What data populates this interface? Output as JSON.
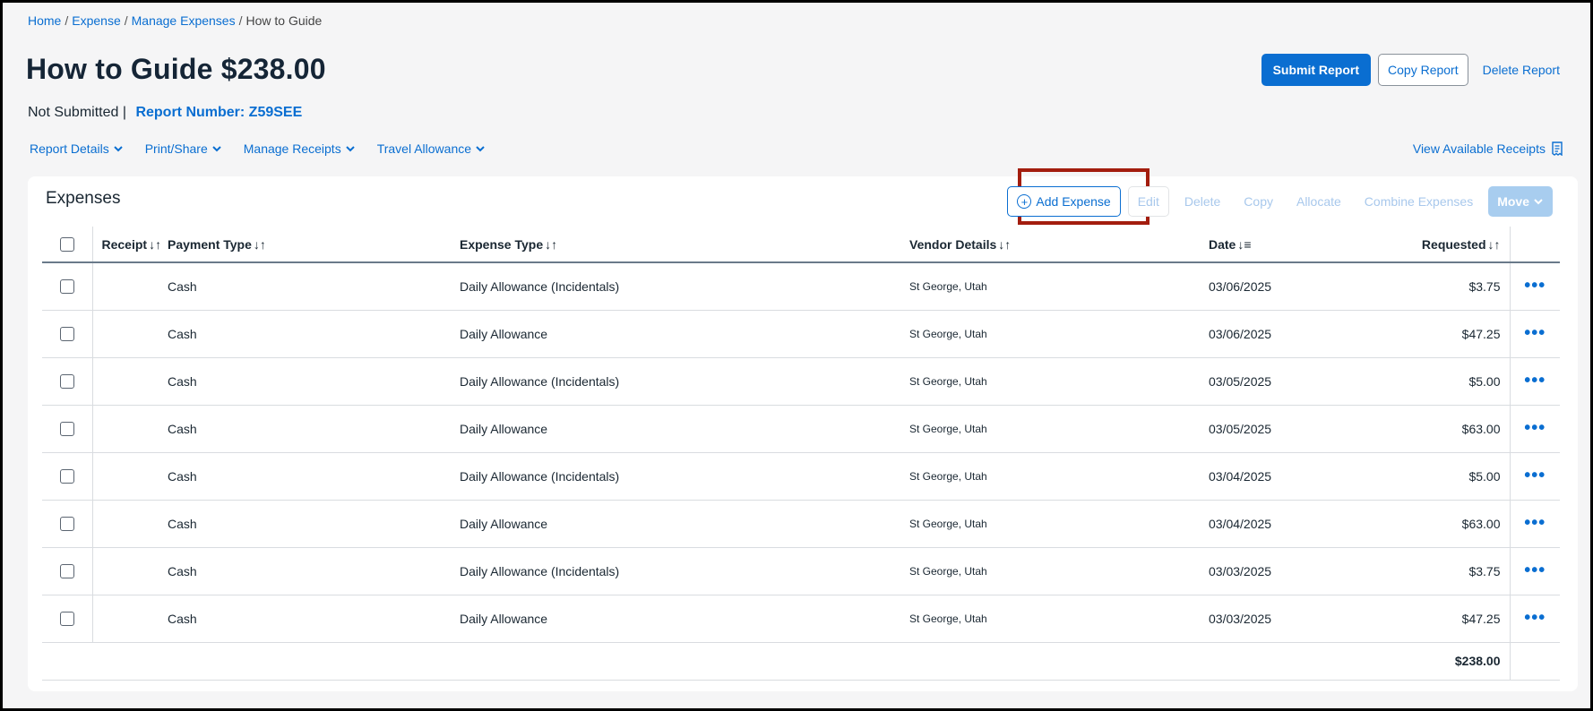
{
  "breadcrumb": {
    "items": [
      "Home",
      "Expense",
      "Manage Expenses"
    ],
    "current": "How to Guide"
  },
  "report": {
    "title": "How to Guide $238.00",
    "status": "Not Submitted |",
    "report_number": "Report Number: Z59SEE"
  },
  "actions": {
    "submit": "Submit Report",
    "copy": "Copy Report",
    "delete": "Delete Report"
  },
  "subnav": {
    "report_details": "Report Details",
    "print_share": "Print/Share",
    "manage_receipts": "Manage Receipts",
    "travel_allowance": "Travel Allowance",
    "view_receipts": "View Available Receipts"
  },
  "expenses": {
    "title": "Expenses",
    "toolbar": {
      "add": "Add Expense",
      "edit": "Edit",
      "delete": "Delete",
      "copy": "Copy",
      "allocate": "Allocate",
      "combine": "Combine Expenses",
      "move": "Move"
    },
    "columns": {
      "receipt": "Receipt",
      "payment_type": "Payment Type",
      "expense_type": "Expense Type",
      "vendor": "Vendor Details",
      "date": "Date",
      "requested": "Requested"
    },
    "rows": [
      {
        "payment": "Cash",
        "type": "Daily Allowance (Incidentals)",
        "vendor": "St George, Utah",
        "date": "03/06/2025",
        "amount": "$3.75"
      },
      {
        "payment": "Cash",
        "type": "Daily Allowance",
        "vendor": "St George, Utah",
        "date": "03/06/2025",
        "amount": "$47.25"
      },
      {
        "payment": "Cash",
        "type": "Daily Allowance (Incidentals)",
        "vendor": "St George, Utah",
        "date": "03/05/2025",
        "amount": "$5.00"
      },
      {
        "payment": "Cash",
        "type": "Daily Allowance",
        "vendor": "St George, Utah",
        "date": "03/05/2025",
        "amount": "$63.00"
      },
      {
        "payment": "Cash",
        "type": "Daily Allowance (Incidentals)",
        "vendor": "St George, Utah",
        "date": "03/04/2025",
        "amount": "$5.00"
      },
      {
        "payment": "Cash",
        "type": "Daily Allowance",
        "vendor": "St George, Utah",
        "date": "03/04/2025",
        "amount": "$63.00"
      },
      {
        "payment": "Cash",
        "type": "Daily Allowance (Incidentals)",
        "vendor": "St George, Utah",
        "date": "03/03/2025",
        "amount": "$3.75"
      },
      {
        "payment": "Cash",
        "type": "Daily Allowance",
        "vendor": "St George, Utah",
        "date": "03/03/2025",
        "amount": "$47.25"
      }
    ],
    "total": "$238.00"
  },
  "colors": {
    "accent": "#0a6ed1",
    "highlight": "#a31d0e",
    "disabled": "#a8c8ec"
  },
  "icons": {
    "add": "plus-circle-icon",
    "chevron": "chevron-down-icon",
    "receipts": "receipt-icon",
    "more": "more-horizontal-icon",
    "sort": "sort-icon"
  }
}
